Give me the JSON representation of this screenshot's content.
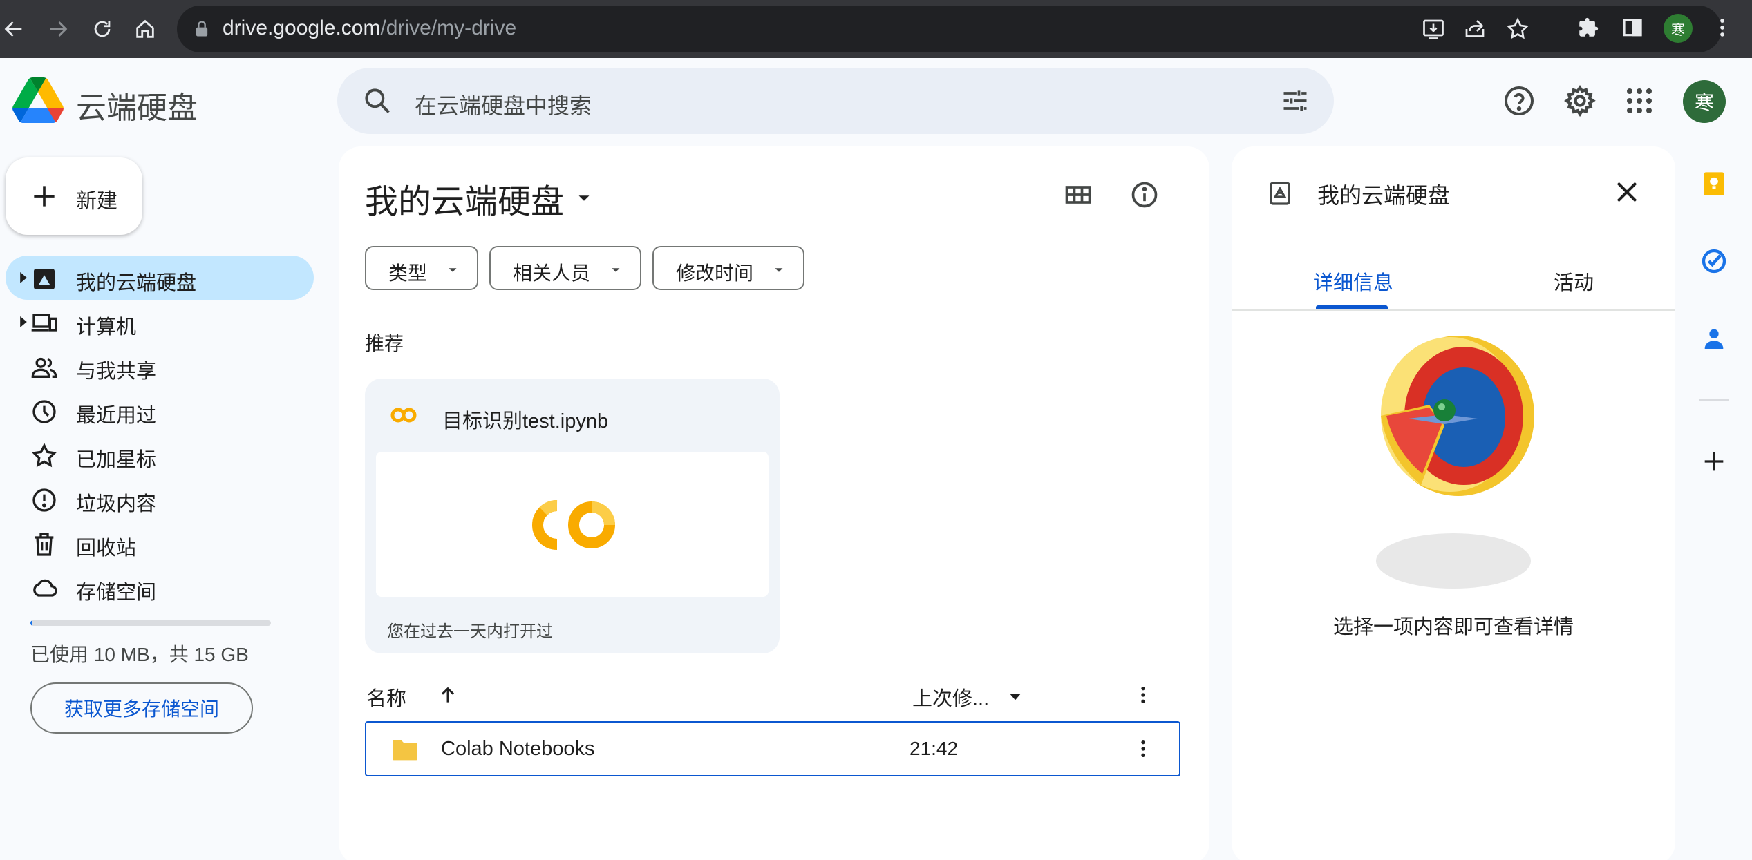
{
  "browser": {
    "url_host": "drive.google.com",
    "url_path": "/drive/my-drive",
    "profile_initial": "寒"
  },
  "header": {
    "app_title": "云端硬盘",
    "search_placeholder": "在云端硬盘中搜索",
    "avatar_initial": "寒"
  },
  "sidebar": {
    "new_label": "新建",
    "items": [
      {
        "label": "我的云端硬盘",
        "icon": "my-drive-icon",
        "active": true
      },
      {
        "label": "计算机",
        "icon": "computers-icon"
      },
      {
        "label": "与我共享",
        "icon": "shared-icon"
      },
      {
        "label": "最近用过",
        "icon": "clock-icon"
      },
      {
        "label": "已加星标",
        "icon": "star-icon"
      },
      {
        "label": "垃圾内容",
        "icon": "spam-icon"
      },
      {
        "label": "回收站",
        "icon": "trash-icon"
      },
      {
        "label": "存储空间",
        "icon": "cloud-icon"
      }
    ],
    "storage_text": "已使用 10 MB，共 15 GB",
    "storage_used_fraction": 0.0007,
    "storage_button": "获取更多存储空间"
  },
  "main": {
    "title": "我的云端硬盘",
    "filters": [
      "类型",
      "相关人员",
      "修改时间"
    ],
    "suggested_label": "推荐",
    "suggested_card": {
      "title": "目标识别test.ipynb",
      "footer": "您在过去一天内打开过"
    },
    "columns": {
      "name": "名称",
      "modified": "上次修..."
    },
    "files": [
      {
        "name": "Colab Notebooks",
        "modified": "21:42"
      }
    ]
  },
  "details": {
    "title": "我的云端硬盘",
    "tabs": [
      "详细信息",
      "活动"
    ],
    "empty_text": "选择一项内容即可查看详情"
  },
  "colors": {
    "accent": "#0b57d0",
    "active_nav": "#c2e7ff",
    "search_bg": "#e9eef6",
    "colab_yellow": "#f9ab00"
  }
}
